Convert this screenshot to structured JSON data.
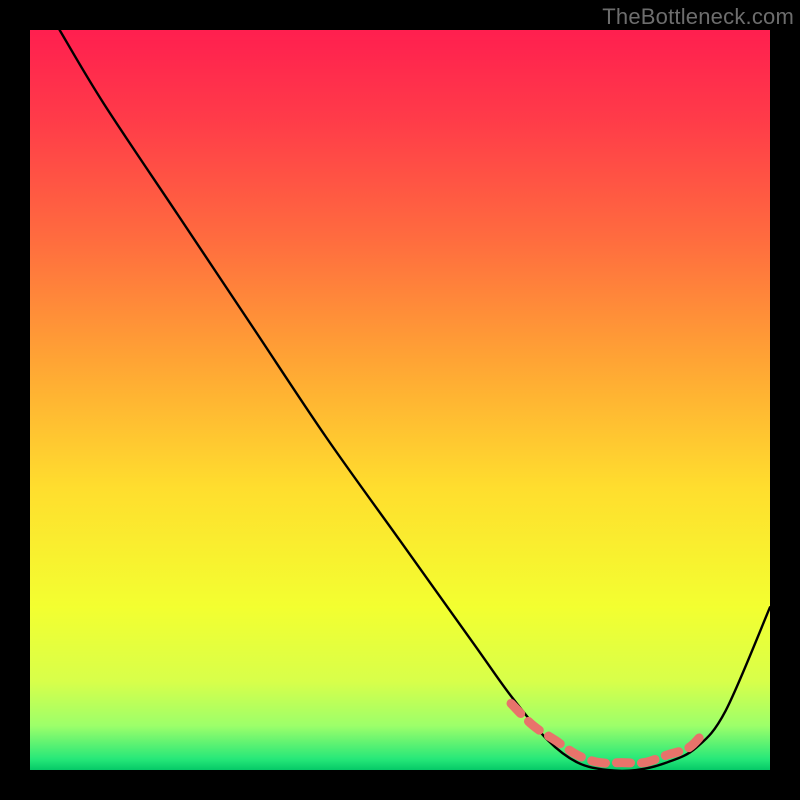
{
  "watermark": "TheBottleneck.com",
  "gradient": {
    "stops": [
      {
        "offset": 0.0,
        "color": "#ff1f4f"
      },
      {
        "offset": 0.12,
        "color": "#ff3b49"
      },
      {
        "offset": 0.28,
        "color": "#ff6b3f"
      },
      {
        "offset": 0.45,
        "color": "#ffa534"
      },
      {
        "offset": 0.62,
        "color": "#ffde2e"
      },
      {
        "offset": 0.78,
        "color": "#f3ff30"
      },
      {
        "offset": 0.88,
        "color": "#d8ff4a"
      },
      {
        "offset": 0.94,
        "color": "#9dff6a"
      },
      {
        "offset": 0.985,
        "color": "#27e879"
      },
      {
        "offset": 1.0,
        "color": "#05c967"
      }
    ]
  },
  "chart_data": {
    "type": "line",
    "title": "",
    "xlabel": "",
    "ylabel": "",
    "xlim": [
      0,
      100
    ],
    "ylim": [
      0,
      100
    ],
    "series": [
      {
        "name": "bottleneck-curve",
        "x": [
          4,
          10,
          20,
          30,
          40,
          50,
          60,
          65,
          70,
          74,
          78,
          82,
          86,
          90,
          94,
          100
        ],
        "values": [
          100,
          90,
          75,
          60,
          45,
          31,
          17,
          10,
          4,
          1,
          0,
          0,
          1,
          3,
          8,
          22
        ]
      }
    ],
    "markers": {
      "name": "highlight-band",
      "color": "#e8736b",
      "x": [
        65,
        68,
        71,
        74,
        77,
        80,
        83,
        86,
        89,
        91
      ],
      "values": [
        9,
        6,
        4,
        2,
        1,
        1,
        1,
        2,
        3,
        5
      ]
    }
  }
}
